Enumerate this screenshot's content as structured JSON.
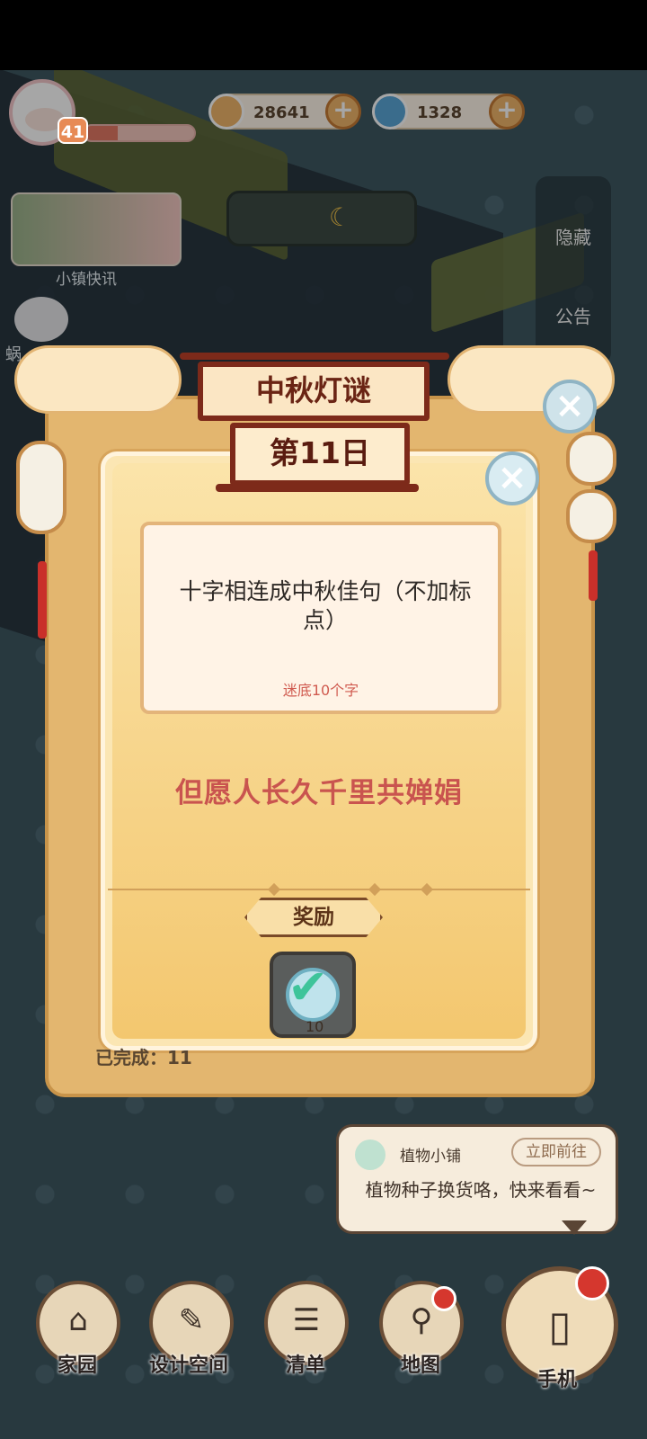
{
  "hud": {
    "level": "41",
    "xp_progress": 0.3,
    "coins": "28641",
    "gems": "1328",
    "plus": "+",
    "coin_color": "#f0b66a",
    "gem_color": "#5aa6d8"
  },
  "left": {
    "news_label": "小镇快讯",
    "side_label": "蜗"
  },
  "right": {
    "hide_label": "隐藏",
    "notice_label": "公告"
  },
  "event": {
    "title": "中秋灯谜",
    "close": "×"
  },
  "dialog": {
    "day": "第11日",
    "close": "×",
    "question": "十字相连成中秋佳句（不加标点）",
    "hint": "迷底10个字",
    "answer": "但愿人长久千里共婵娟",
    "reward_label": "奖励",
    "reward_qty": "10",
    "done_text": "已完成：11"
  },
  "shop": {
    "name": "植物小铺",
    "go_label": "立即前往",
    "message": "植物种子换货咯，快来看看~"
  },
  "nav": [
    {
      "label": "家园",
      "icon": "home-icon"
    },
    {
      "label": "设计空间",
      "icon": "design-icon"
    },
    {
      "label": "清单",
      "icon": "list-icon"
    },
    {
      "label": "地图",
      "icon": "map-pin-icon"
    },
    {
      "label": "手机",
      "icon": "phone-icon"
    }
  ]
}
